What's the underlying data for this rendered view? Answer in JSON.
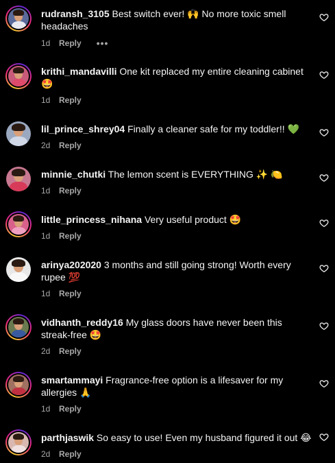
{
  "comments": [
    {
      "username": "rudransh_3105",
      "text": "Best switch ever! 🙌 No more toxic smell headaches",
      "time": "1d",
      "reply": "Reply",
      "more": "•••",
      "avatar_ring": true,
      "avatar_bg": "#5a6a9a",
      "avatar_body": "#e8e8f0"
    },
    {
      "username": "krithi_mandavilli",
      "text": "One kit replaced my entire cleaning cabinet 🤩",
      "time": "1d",
      "reply": "Reply",
      "avatar_ring": true,
      "avatar_bg": "#c85a7a",
      "avatar_body": "#e04a6a"
    },
    {
      "username": "lil_prince_shrey04",
      "text": "Finally a cleaner safe for my toddler!! 💚",
      "time": "2d",
      "reply": "Reply",
      "avatar_ring": false,
      "avatar_bg": "#9aa8c0",
      "avatar_body": "#d0d8e8"
    },
    {
      "username": "minnie_chutki",
      "text": "The lemon scent is EVERYTHING ✨ 🍋",
      "time": "1d",
      "reply": "Reply",
      "avatar_ring": false,
      "avatar_bg": "#c87890",
      "avatar_body": "#d83a5a"
    },
    {
      "username": "little_princess_nihana",
      "text": "Very useful product 🤩",
      "time": "1d",
      "reply": "Reply",
      "avatar_ring": true,
      "avatar_bg": "#d8608a",
      "avatar_body": "#f0a0c0"
    },
    {
      "username": "arinya202020",
      "text": "3 months and still going strong! Worth every rupee 💯",
      "time": "1d",
      "reply": "Reply",
      "avatar_ring": false,
      "avatar_bg": "#e8e8e8",
      "avatar_body": "#f8f8f8"
    },
    {
      "username": "vidhanth_reddy16",
      "text": "My glass doors have never been this streak-free 🤩",
      "time": "2d",
      "reply": "Reply",
      "avatar_ring": true,
      "avatar_bg": "#6a7a50",
      "avatar_body": "#3a5aa0"
    },
    {
      "username": "smartammayi",
      "text": "Fragrance-free option is a lifesaver for my allergies 🙏",
      "time": "1d",
      "reply": "Reply",
      "avatar_ring": true,
      "avatar_bg": "#a07060",
      "avatar_body": "#c03040"
    },
    {
      "username": "parthjaswik",
      "text": "So easy to use! Even my husband figured it out 😂",
      "time": "2d",
      "reply": "Reply",
      "avatar_ring": true,
      "avatar_bg": "#d8b8b0",
      "avatar_body": "#f0e0e0"
    }
  ],
  "icons": {
    "like": "heart-outline-icon"
  }
}
